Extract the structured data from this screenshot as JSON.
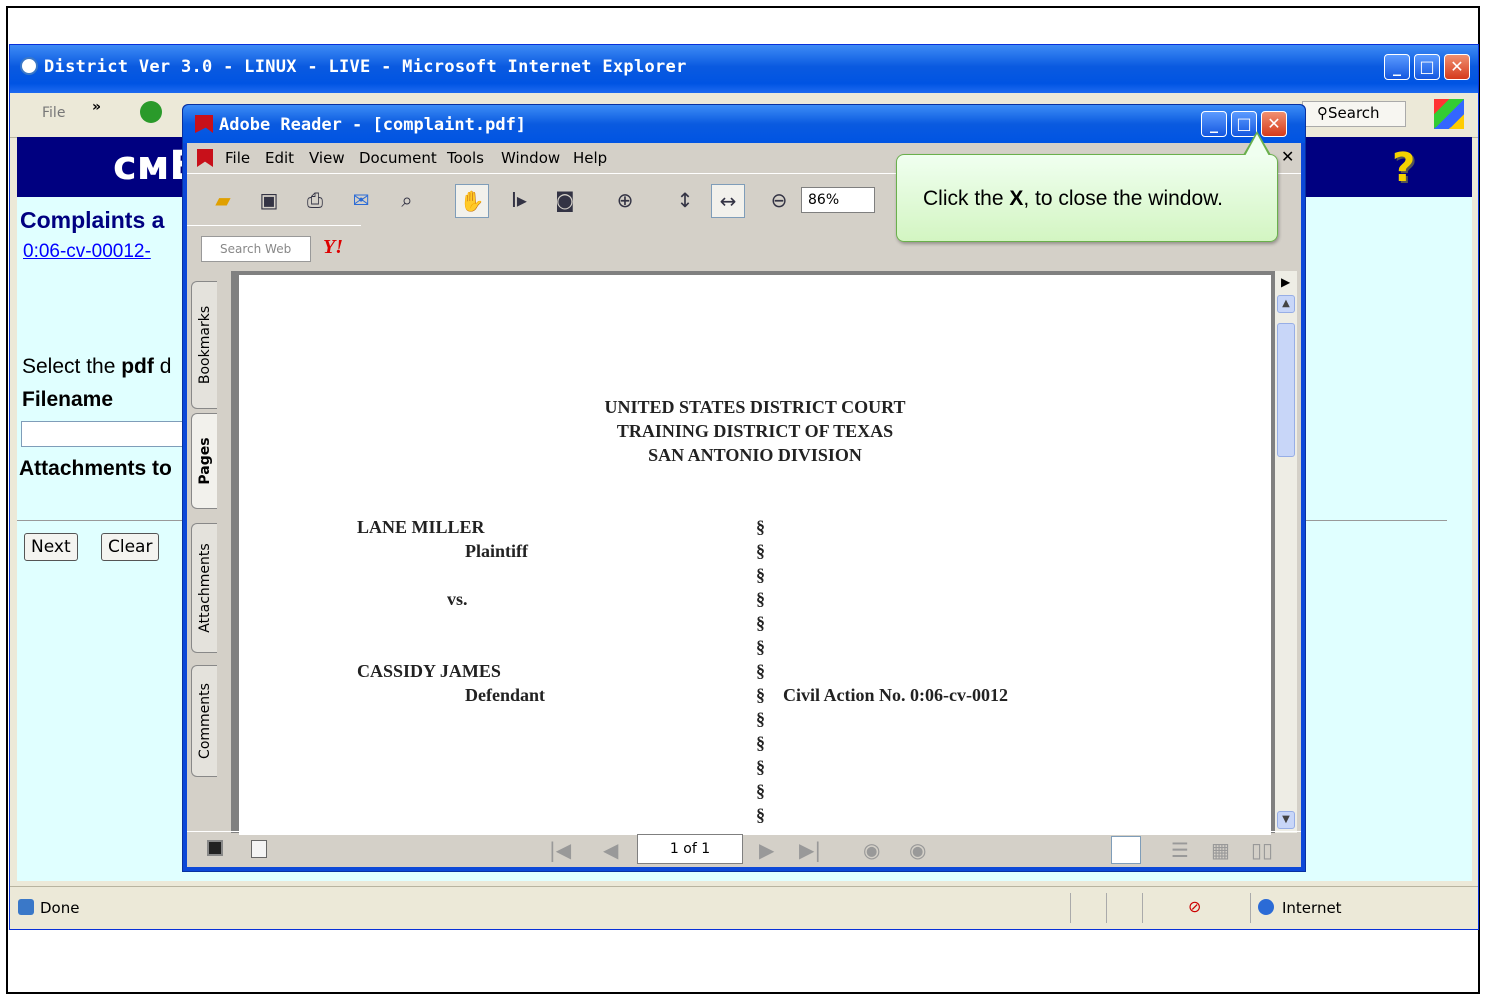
{
  "ie": {
    "title": "District Ver 3.0 - LINUX - LIVE - Microsoft Internet Explorer",
    "menu_file": "File",
    "search_label": "Search",
    "status_done": "Done",
    "zone": "Internet"
  },
  "page": {
    "logo": "ᴄᴍECF",
    "title": "Complaints a",
    "case_link": "0:06-cv-00012-",
    "select_prefix": "Select the ",
    "select_bold": "pdf",
    "select_suffix": " d",
    "filename_label": "Filename",
    "attachments_label": "Attachments to",
    "next_button": "Next",
    "clear_button": "Clear"
  },
  "reader": {
    "title": "Adobe Reader - [complaint.pdf]",
    "menu": [
      "File",
      "Edit",
      "View",
      "Document",
      "Tools",
      "Window",
      "Help"
    ],
    "zoom": "86%",
    "search_placeholder": "Search Web",
    "yahoo": "Y!",
    "tabs": [
      "Bookmarks",
      "Pages",
      "Attachments",
      "Comments"
    ],
    "page_indicator": "1 of 1"
  },
  "document": {
    "court_lines": [
      "UNITED STATES DISTRICT COURT",
      "TRAINING DISTRICT OF TEXAS",
      "SAN ANTONIO DIVISION"
    ],
    "plaintiff_name": "LANE MILLER",
    "plaintiff_role": "Plaintiff",
    "versus": "vs.",
    "defendant_name": "CASSIDY JAMES",
    "defendant_role": "Defendant",
    "section_mark": "§",
    "civil_action": "Civil Action No.  0:06-cv-0012"
  },
  "callout": {
    "prefix": "Click the ",
    "bold": "X",
    "suffix": ", to close the window."
  }
}
